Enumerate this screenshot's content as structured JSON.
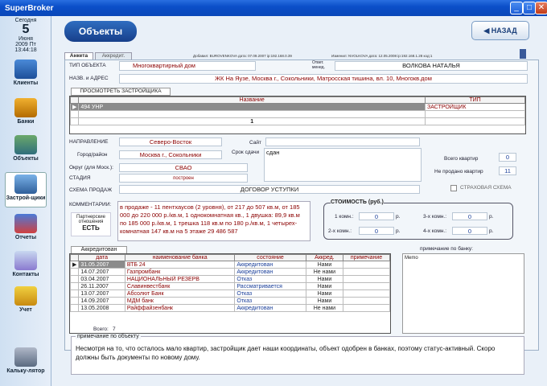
{
  "window": {
    "title": "SuperBroker",
    "min": "_",
    "max": "□",
    "close": "✕"
  },
  "date": {
    "today_label": "Сегодня",
    "day": "5",
    "month": "Июня",
    "year_dow": "2009  Пт",
    "time": "13:44:18"
  },
  "nav": [
    "Клиенты",
    "Банки",
    "Объекты",
    "Застрой-щики",
    "Отчеты",
    "Контакты",
    "Учет",
    "Кальку-лятор"
  ],
  "header": {
    "title": "Объекты",
    "back": "НАЗАД"
  },
  "tabs": [
    "Анкета",
    "Аккредит."
  ],
  "meta": {
    "added": "Добавил: BUROVENKOVA дата: 07.09.2007 ip:192.168.0.39",
    "changed": "Изменил: NVOLKOVA дата: 12.05.2008 ip:192.168.1.28  код:1"
  },
  "form": {
    "type_label": "ТИП ОБЪЕКТА",
    "type_value": "Многоквартирный дом",
    "resp_label": "Ответ. менед.",
    "resp_value": "ВОЛКОВА НАТАЛЬЯ",
    "addr_label": "НАЗВ. и АДРЕС",
    "addr_value": "ЖК На Яузе, Москва г., Сокольники, Матросская тишина, вл. 10,  Многокв.дом",
    "view_builders": "ПРОСМОТРЕТЬ  ЗАСТРОЙЩИКА",
    "dir_label": "НАПРАВЛЕНИЕ",
    "dir_value": "Северо-Восток",
    "city_label": "Город/район",
    "city_value": "Москва г., Сокольники",
    "okrug_label": "Округ (для Моск.):",
    "okrug_value": "СВАО",
    "stage_label": "СТАДИЯ",
    "stage_value": "построен",
    "site_label": "Сайт",
    "term_label": "Срок сдачи",
    "term_value": "сдан",
    "total_label": "Всего квартир",
    "total_value": "0",
    "unsold_label": "Не продано квартир",
    "unsold_value": "11",
    "scheme_label": "СХЕМА ПРОДАЖ",
    "scheme_value": "ДОГОВОР УСТУПКИ",
    "insurance": "СТРАХОВАЯ СХЕМА",
    "comments_label": "КОММЕНТАРИИ:",
    "comments": "в продаже - 11 пентхаусов (2 уровня), от 217 до 507 кв.м, от 185 000 до 220 000 р./кв.м, 1 однокомнатная кв., 1 двушка: 89,9 кв.м по 185 000 р./кв.м, 1 трешка 118 кв.м по 180 р./кв.м, 1 четырех-комнатная 147 кв.м на 5 этаже 29 486 587",
    "partner_label": "Партнерские отношения",
    "partner_value": "ЕСТЬ"
  },
  "builders": {
    "col_name": "Название",
    "col_type": "ТИП",
    "rows": [
      [
        "494 УНР",
        "ЗАСТРОЙЩИК"
      ]
    ],
    "count": "1"
  },
  "price": {
    "title": "СТОИМОСТЬ (руб.)",
    "r1": "1 комн.:",
    "r2": "2-х комн.:",
    "r3": "3-х комн.:",
    "r4": "4-х комн.:",
    "v1": "0",
    "v2": "0",
    "v3": "0",
    "v4": "0",
    "cur": "р."
  },
  "accr": {
    "title": "Аккредитован",
    "cols": [
      "дата",
      "наименование банка",
      "состояние",
      "Аккред.",
      "примечание"
    ],
    "rows": [
      [
        "31.05.2007",
        "ВТБ 24",
        "Аккредитован",
        "Нами",
        ""
      ],
      [
        "14.07.2007",
        "Газпромбанк",
        "Аккредитован",
        "Не нами",
        ""
      ],
      [
        "03.04.2007",
        "НАЦИОНАЛЬНЫЙ РЕЗЕРВ",
        "Отказ",
        "Нами",
        ""
      ],
      [
        "26.11.2007",
        "Славинвестбанк",
        "Рассматривается",
        "Нами",
        ""
      ],
      [
        "13.07.2007",
        "Абсолют Банк",
        "Отказ",
        "Нами",
        ""
      ],
      [
        "14.09.2007",
        "МДМ банк",
        "Отказ",
        "Нами",
        ""
      ],
      [
        "13.05.2008",
        "Райффайзенбанк",
        "Аккредитован",
        "Не нами",
        ""
      ]
    ],
    "total_label": "Всего:",
    "total": "7",
    "note_label": "примечание по банку:",
    "memo": "Memo"
  },
  "note": {
    "label": "примечание по объекту",
    "text": "Несмотря на то, что осталось мало квартир, застройщик дает наши координаты, объект одобрен в банках, поэтому статус-активный. Скоро должны быть документы по новому дому."
  },
  "colors": {
    "accent": "#1a4f9c",
    "field_text": "#8b0000",
    "selected": "#8b8b8b"
  }
}
